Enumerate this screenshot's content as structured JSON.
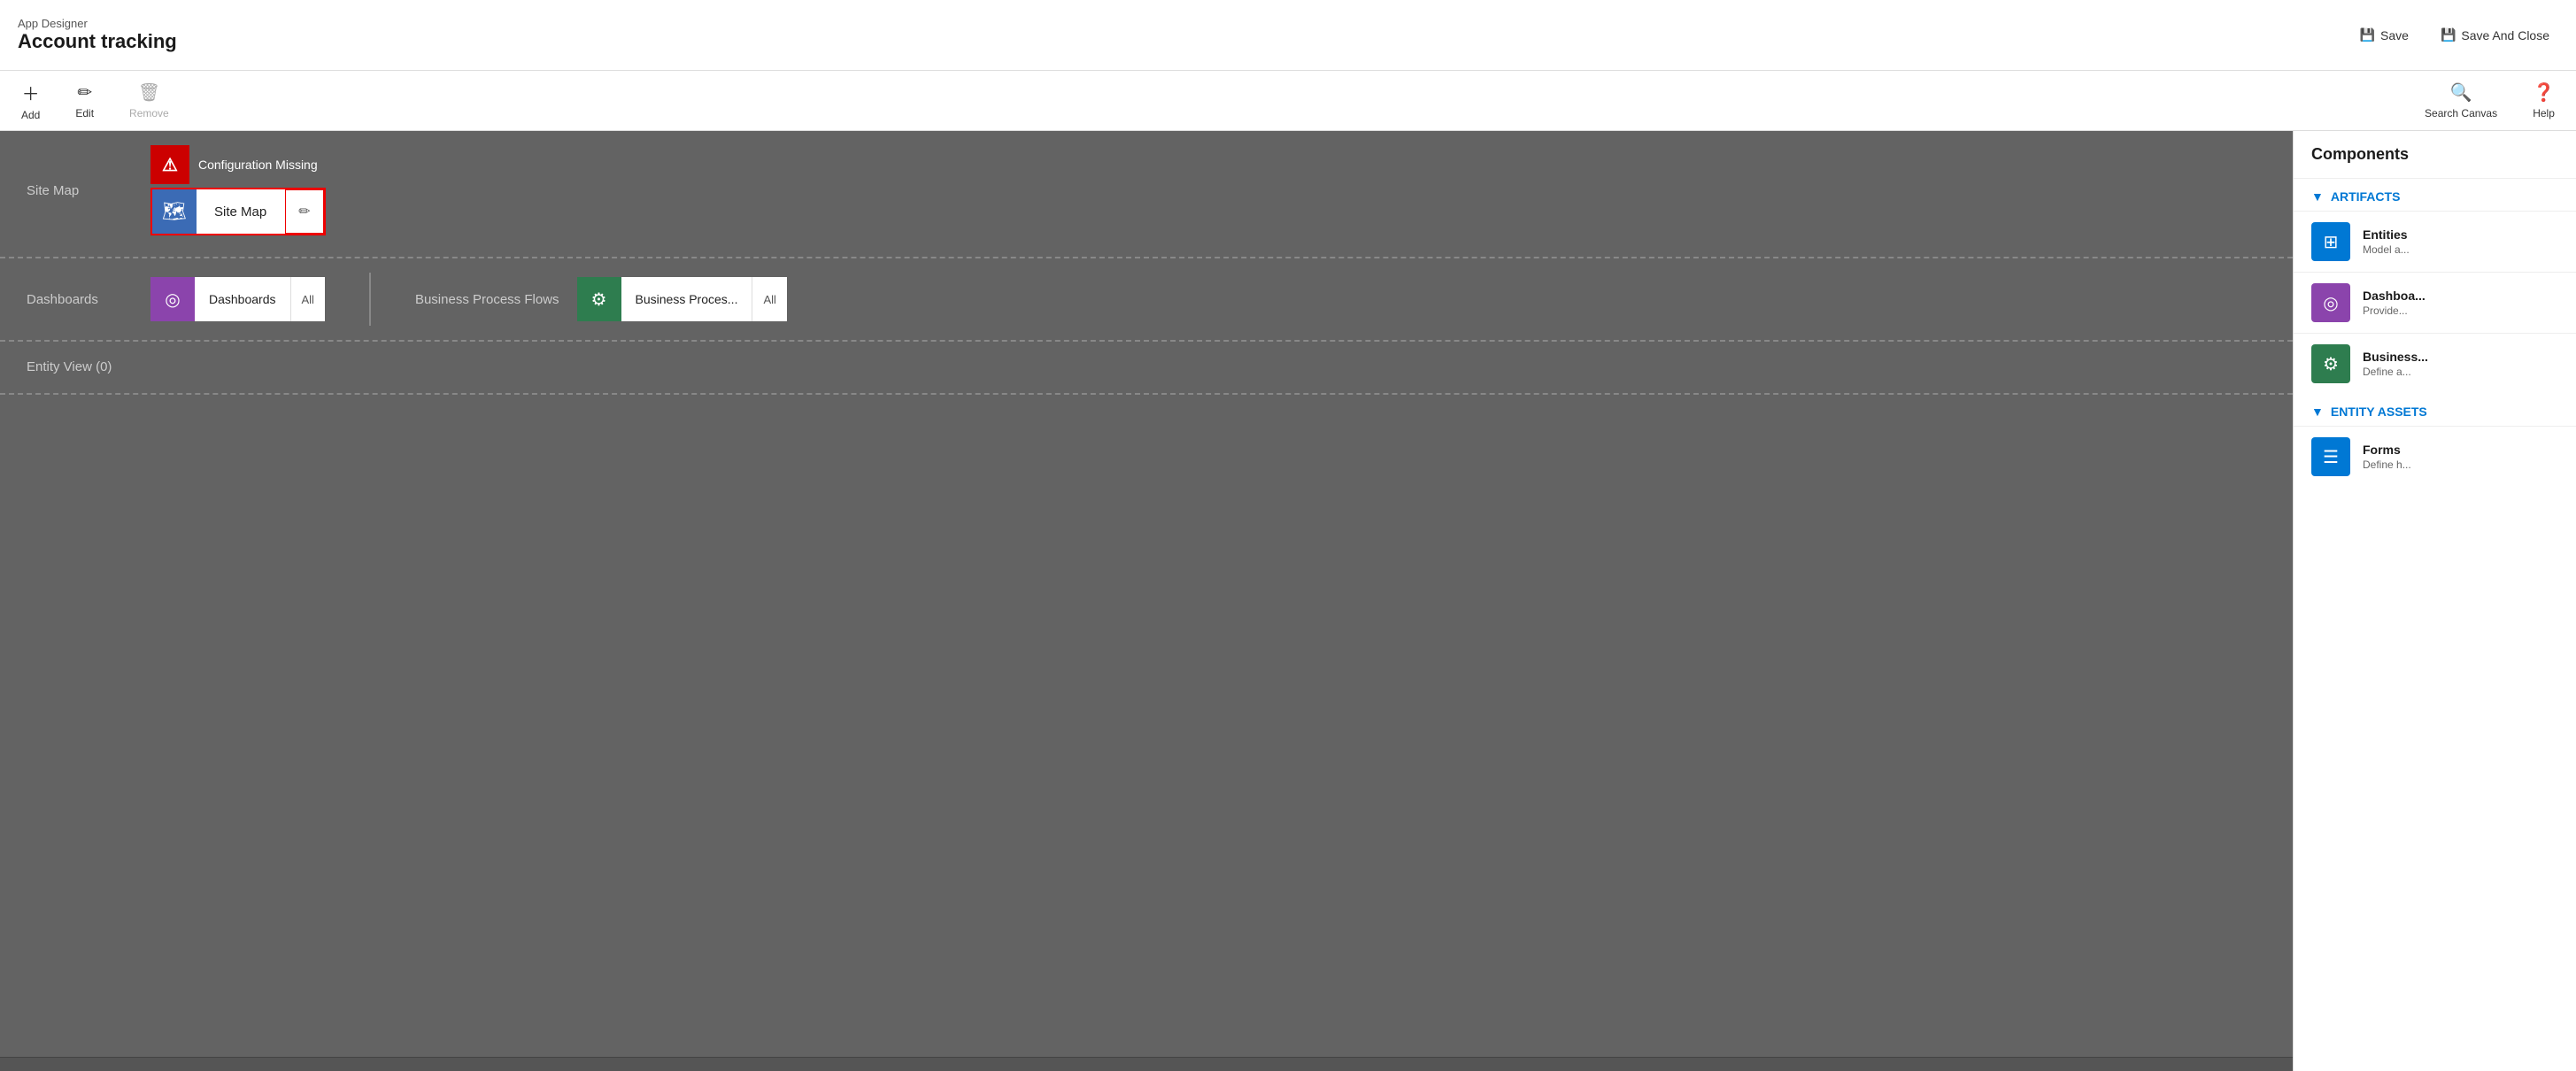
{
  "header": {
    "app_subtitle": "App Designer",
    "app_title": "Account tracking",
    "save_label": "Save",
    "save_close_label": "Save And Close"
  },
  "toolbar": {
    "add_label": "Add",
    "edit_label": "Edit",
    "remove_label": "Remove",
    "search_canvas_label": "Search Canvas",
    "help_label": "Help"
  },
  "canvas": {
    "sitemap_label": "Site Map",
    "config_missing_label": "Configuration Missing",
    "sitemap_card_label": "Site Map",
    "dashboards_label": "Dashboards",
    "dashboard_card_label": "Dashboards",
    "dashboard_card_action": "All",
    "bpf_label": "Business Process Flows",
    "bpf_card_label": "Business Proces...",
    "bpf_card_action": "All",
    "entity_view_label": "Entity View (0)"
  },
  "components_panel": {
    "title": "Components",
    "artifacts_section": "ARTIFACTS",
    "entity_assets_section": "ENTITY ASSETS",
    "items": [
      {
        "id": "entities",
        "icon_type": "blue",
        "icon_symbol": "⊞",
        "title": "Entities",
        "desc": "Model a..."
      },
      {
        "id": "dashboards",
        "icon_type": "purple",
        "icon_symbol": "◎",
        "title": "Dashboa...",
        "desc": "Provide..."
      },
      {
        "id": "business-process",
        "icon_type": "green",
        "icon_symbol": "⚙",
        "title": "Business...",
        "desc": "Define a..."
      }
    ],
    "entity_assets_items": [
      {
        "id": "forms",
        "icon_type": "blue-doc",
        "icon_symbol": "☰",
        "title": "Forms",
        "desc": "Define h..."
      }
    ]
  }
}
